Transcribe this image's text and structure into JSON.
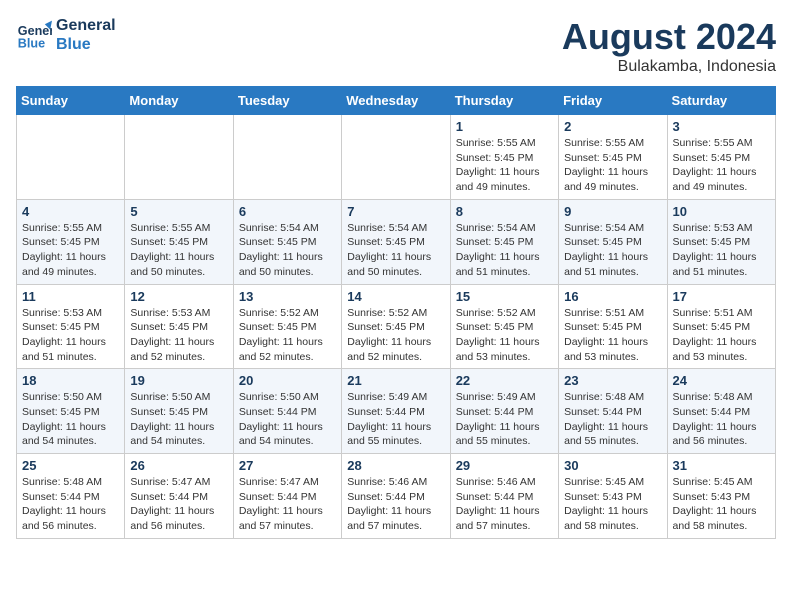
{
  "header": {
    "logo_line1": "General",
    "logo_line2": "Blue",
    "month_year": "August 2024",
    "location": "Bulakamba, Indonesia"
  },
  "weekdays": [
    "Sunday",
    "Monday",
    "Tuesday",
    "Wednesday",
    "Thursday",
    "Friday",
    "Saturday"
  ],
  "weeks": [
    [
      {
        "day": "",
        "info": ""
      },
      {
        "day": "",
        "info": ""
      },
      {
        "day": "",
        "info": ""
      },
      {
        "day": "",
        "info": ""
      },
      {
        "day": "1",
        "info": "Sunrise: 5:55 AM\nSunset: 5:45 PM\nDaylight: 11 hours\nand 49 minutes."
      },
      {
        "day": "2",
        "info": "Sunrise: 5:55 AM\nSunset: 5:45 PM\nDaylight: 11 hours\nand 49 minutes."
      },
      {
        "day": "3",
        "info": "Sunrise: 5:55 AM\nSunset: 5:45 PM\nDaylight: 11 hours\nand 49 minutes."
      }
    ],
    [
      {
        "day": "4",
        "info": "Sunrise: 5:55 AM\nSunset: 5:45 PM\nDaylight: 11 hours\nand 49 minutes."
      },
      {
        "day": "5",
        "info": "Sunrise: 5:55 AM\nSunset: 5:45 PM\nDaylight: 11 hours\nand 50 minutes."
      },
      {
        "day": "6",
        "info": "Sunrise: 5:54 AM\nSunset: 5:45 PM\nDaylight: 11 hours\nand 50 minutes."
      },
      {
        "day": "7",
        "info": "Sunrise: 5:54 AM\nSunset: 5:45 PM\nDaylight: 11 hours\nand 50 minutes."
      },
      {
        "day": "8",
        "info": "Sunrise: 5:54 AM\nSunset: 5:45 PM\nDaylight: 11 hours\nand 51 minutes."
      },
      {
        "day": "9",
        "info": "Sunrise: 5:54 AM\nSunset: 5:45 PM\nDaylight: 11 hours\nand 51 minutes."
      },
      {
        "day": "10",
        "info": "Sunrise: 5:53 AM\nSunset: 5:45 PM\nDaylight: 11 hours\nand 51 minutes."
      }
    ],
    [
      {
        "day": "11",
        "info": "Sunrise: 5:53 AM\nSunset: 5:45 PM\nDaylight: 11 hours\nand 51 minutes."
      },
      {
        "day": "12",
        "info": "Sunrise: 5:53 AM\nSunset: 5:45 PM\nDaylight: 11 hours\nand 52 minutes."
      },
      {
        "day": "13",
        "info": "Sunrise: 5:52 AM\nSunset: 5:45 PM\nDaylight: 11 hours\nand 52 minutes."
      },
      {
        "day": "14",
        "info": "Sunrise: 5:52 AM\nSunset: 5:45 PM\nDaylight: 11 hours\nand 52 minutes."
      },
      {
        "day": "15",
        "info": "Sunrise: 5:52 AM\nSunset: 5:45 PM\nDaylight: 11 hours\nand 53 minutes."
      },
      {
        "day": "16",
        "info": "Sunrise: 5:51 AM\nSunset: 5:45 PM\nDaylight: 11 hours\nand 53 minutes."
      },
      {
        "day": "17",
        "info": "Sunrise: 5:51 AM\nSunset: 5:45 PM\nDaylight: 11 hours\nand 53 minutes."
      }
    ],
    [
      {
        "day": "18",
        "info": "Sunrise: 5:50 AM\nSunset: 5:45 PM\nDaylight: 11 hours\nand 54 minutes."
      },
      {
        "day": "19",
        "info": "Sunrise: 5:50 AM\nSunset: 5:45 PM\nDaylight: 11 hours\nand 54 minutes."
      },
      {
        "day": "20",
        "info": "Sunrise: 5:50 AM\nSunset: 5:44 PM\nDaylight: 11 hours\nand 54 minutes."
      },
      {
        "day": "21",
        "info": "Sunrise: 5:49 AM\nSunset: 5:44 PM\nDaylight: 11 hours\nand 55 minutes."
      },
      {
        "day": "22",
        "info": "Sunrise: 5:49 AM\nSunset: 5:44 PM\nDaylight: 11 hours\nand 55 minutes."
      },
      {
        "day": "23",
        "info": "Sunrise: 5:48 AM\nSunset: 5:44 PM\nDaylight: 11 hours\nand 55 minutes."
      },
      {
        "day": "24",
        "info": "Sunrise: 5:48 AM\nSunset: 5:44 PM\nDaylight: 11 hours\nand 56 minutes."
      }
    ],
    [
      {
        "day": "25",
        "info": "Sunrise: 5:48 AM\nSunset: 5:44 PM\nDaylight: 11 hours\nand 56 minutes."
      },
      {
        "day": "26",
        "info": "Sunrise: 5:47 AM\nSunset: 5:44 PM\nDaylight: 11 hours\nand 56 minutes."
      },
      {
        "day": "27",
        "info": "Sunrise: 5:47 AM\nSunset: 5:44 PM\nDaylight: 11 hours\nand 57 minutes."
      },
      {
        "day": "28",
        "info": "Sunrise: 5:46 AM\nSunset: 5:44 PM\nDaylight: 11 hours\nand 57 minutes."
      },
      {
        "day": "29",
        "info": "Sunrise: 5:46 AM\nSunset: 5:44 PM\nDaylight: 11 hours\nand 57 minutes."
      },
      {
        "day": "30",
        "info": "Sunrise: 5:45 AM\nSunset: 5:43 PM\nDaylight: 11 hours\nand 58 minutes."
      },
      {
        "day": "31",
        "info": "Sunrise: 5:45 AM\nSunset: 5:43 PM\nDaylight: 11 hours\nand 58 minutes."
      }
    ]
  ]
}
